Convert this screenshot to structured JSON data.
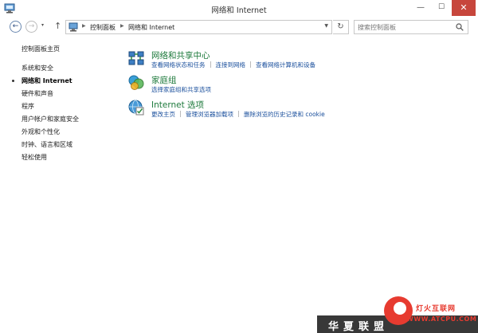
{
  "window": {
    "title": "网络和 Internet",
    "controls": {
      "minimize": "—",
      "maximize": "☐",
      "close": "✕"
    }
  },
  "nav": {
    "back": "←",
    "forward": "→",
    "recent": "▾",
    "up": "↑",
    "breadcrumbs": [
      "控制面板",
      "网络和 Internet"
    ],
    "refresh": "↻",
    "search_placeholder": "搜索控制面板"
  },
  "sidebar": {
    "home": "控制面板主页",
    "items": [
      {
        "label": "系统和安全",
        "active": false
      },
      {
        "label": "网络和 Internet",
        "active": true
      },
      {
        "label": "硬件和声音",
        "active": false
      },
      {
        "label": "程序",
        "active": false
      },
      {
        "label": "用户帐户和家庭安全",
        "active": false
      },
      {
        "label": "外观和个性化",
        "active": false
      },
      {
        "label": "时钟、语言和区域",
        "active": false
      },
      {
        "label": "轻松使用",
        "active": false
      }
    ]
  },
  "categories": [
    {
      "icon": "network-sharing-center-icon",
      "title": "网络和共享中心",
      "links": [
        "查看网络状态和任务",
        "连接到网络",
        "查看网络计算机和设备"
      ]
    },
    {
      "icon": "homegroup-icon",
      "title": "家庭组",
      "links": [
        "选择家庭组和共享选项"
      ]
    },
    {
      "icon": "internet-options-icon",
      "title": "Internet 选项",
      "links": [
        "更改主页",
        "管理浏览器加载项",
        "删除浏览的历史记录和 cookie"
      ]
    }
  ],
  "watermark": {
    "site_name": "灯火互联网",
    "site_url": "WWW.ATCPU.COM",
    "band_text": "华夏联盟"
  },
  "colors": {
    "link": "#1a4f9c",
    "category_title": "#1e7a3c",
    "close_button": "#c7463c",
    "watermark_red": "#e73b30"
  }
}
